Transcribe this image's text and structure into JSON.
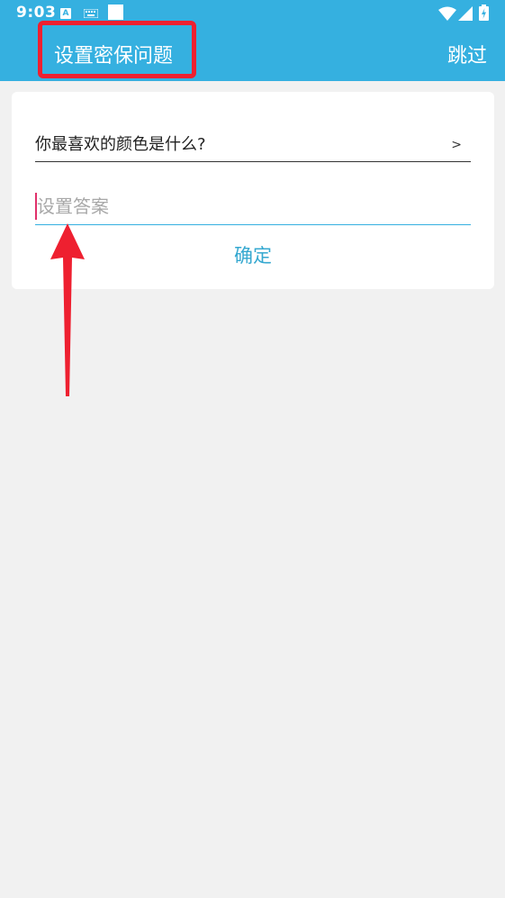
{
  "status_bar": {
    "time": "9:03",
    "icons": [
      "text-input-icon",
      "keyboard-icon",
      "notification-square-icon",
      "wifi-icon",
      "signal-icon",
      "battery-charging-icon"
    ]
  },
  "app_bar": {
    "title": "设置密保问题",
    "skip_label": "跳过"
  },
  "form": {
    "question": "你最喜欢的颜色是什么?",
    "question_arrow": ">",
    "answer_placeholder": "设置答案",
    "answer_value": "",
    "confirm_label": "确定"
  },
  "colors": {
    "accent": "#35b0e0",
    "annotation": "#ee2030",
    "background": "#f1f1f1"
  }
}
